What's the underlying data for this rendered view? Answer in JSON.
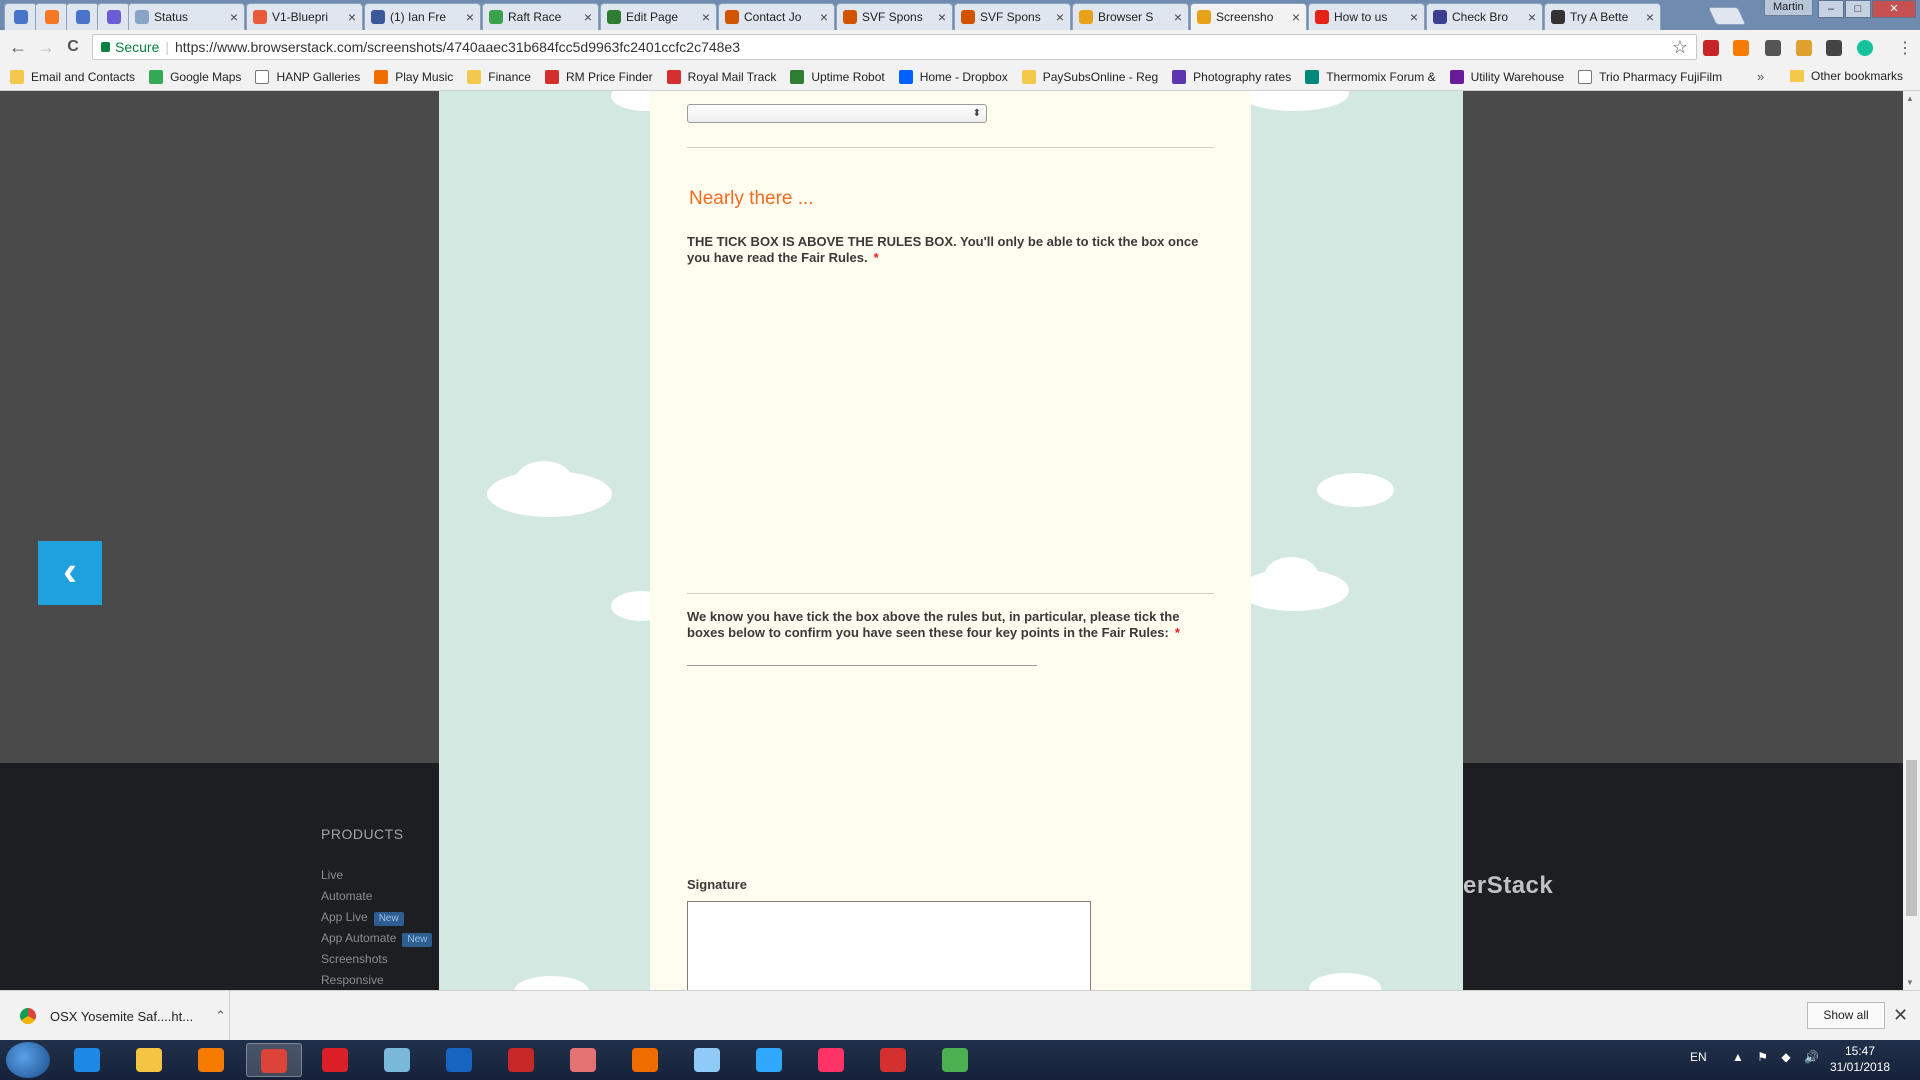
{
  "tabs": [
    {
      "title": "",
      "icon": "inbox-icon",
      "color": "#4a74c9",
      "pinned": true
    },
    {
      "title": "",
      "icon": "hubspot-icon",
      "color": "#f57722",
      "pinned": true
    },
    {
      "title": "",
      "icon": "rocket-icon",
      "color": "#4a74c9",
      "pinned": true
    },
    {
      "title": "",
      "icon": "circle-icon",
      "color": "#6b5bd6",
      "pinned": true
    },
    {
      "title": "Status",
      "icon": "status-icon",
      "color": "#8aa4c8"
    },
    {
      "title": "V1-Bluepri",
      "icon": "blueprint-icon",
      "color": "#e85a3a"
    },
    {
      "title": "(1) Ian Fre",
      "icon": "facebook-icon",
      "color": "#3b5998"
    },
    {
      "title": "Raft Race",
      "icon": "raft-icon",
      "color": "#39a24a"
    },
    {
      "title": "Edit Page",
      "icon": "edit-page-icon",
      "color": "#2e7d32"
    },
    {
      "title": "Contact Jo",
      "icon": "page-icon",
      "color": "#d35400"
    },
    {
      "title": "SVF Spons",
      "icon": "page-icon",
      "color": "#d35400"
    },
    {
      "title": "SVF Spons",
      "icon": "page-icon",
      "color": "#d35400"
    },
    {
      "title": "Browser S",
      "icon": "browserstack-icon",
      "color": "#e8a21a"
    },
    {
      "title": "Screensho",
      "icon": "browserstack-icon",
      "color": "#e8a21a",
      "active": true
    },
    {
      "title": "How to us",
      "icon": "youtube-icon",
      "color": "#e62117"
    },
    {
      "title": "Check Bro",
      "icon": "shield-icon",
      "color": "#3b3f8f"
    },
    {
      "title": "Try A Bette",
      "icon": "github-icon",
      "color": "#333333"
    }
  ],
  "window": {
    "profile": "Martin",
    "min": "–",
    "max": "□",
    "close": "✕"
  },
  "toolbar": {
    "back": "←",
    "forward": "→",
    "reload": "C",
    "secure_label": "Secure",
    "url": "https://www.browserstack.com/screenshots/4740aaec31b684fcc5d9963fc2401ccfc2c748e3",
    "star": "☆",
    "menu": "⋮"
  },
  "bookmarks": [
    {
      "label": "Email and Contacts",
      "icon": "folder-icon",
      "color": "#f2c94c"
    },
    {
      "label": "Google Maps",
      "icon": "maps-icon",
      "color": "#34a853"
    },
    {
      "label": "HANP Galleries",
      "icon": "page-icon",
      "color": "#ffffff"
    },
    {
      "label": "Play Music",
      "icon": "play-music-icon",
      "color": "#ef6c00"
    },
    {
      "label": "Finance",
      "icon": "folder-icon",
      "color": "#f2c94c"
    },
    {
      "label": "RM Price Finder",
      "icon": "royal-mail-icon",
      "color": "#d32f2f"
    },
    {
      "label": "Royal Mail Track",
      "icon": "royal-mail-icon",
      "color": "#d32f2f"
    },
    {
      "label": "Uptime Robot",
      "icon": "uptime-icon",
      "color": "#2e7d32"
    },
    {
      "label": "Home - Dropbox",
      "icon": "dropbox-icon",
      "color": "#0061ff"
    },
    {
      "label": "PaySubsOnline - Reg",
      "icon": "folder-icon",
      "color": "#f2c94c"
    },
    {
      "label": "Photography rates",
      "icon": "photo-icon",
      "color": "#5e35b1"
    },
    {
      "label": "Thermomix Forum &",
      "icon": "forum-icon",
      "color": "#00897b"
    },
    {
      "label": "Utility Warehouse",
      "icon": "utility-icon",
      "color": "#6a1b9a"
    },
    {
      "label": "Trio Pharmacy FujiFilm",
      "icon": "page-icon",
      "color": "#ffffff"
    }
  ],
  "bookmarks_more": "»",
  "other_bookmarks": "Other bookmarks",
  "form": {
    "section_heading": "Nearly there ...",
    "tickbox_label": "THE TICK BOX IS ABOVE THE RULES BOX. You'll only be able to tick the box once you have read the Fair Rules.",
    "keypoints_label": "We know you have tick the box above the rules but, in particular, please tick the boxes below to confirm you have seen these four key points in the Fair Rules:",
    "required_mark": "*",
    "signature_label": "Signature"
  },
  "footer": {
    "products_heading": "PRODUCTS",
    "links": [
      {
        "label": "Live",
        "badge": ""
      },
      {
        "label": "Automate",
        "badge": ""
      },
      {
        "label": "App Live",
        "badge": "New"
      },
      {
        "label": "App Automate",
        "badge": "New"
      },
      {
        "label": "Screenshots",
        "badge": ""
      },
      {
        "label": "Responsive",
        "badge": ""
      }
    ],
    "brand_partial": "wserStack"
  },
  "back_button": "‹",
  "download": {
    "file": "OSX Yosemite Saf....ht...",
    "show_all": "Show all",
    "close": "✕"
  },
  "taskbar": {
    "apps": [
      {
        "icon": "ie-icon",
        "color": "#1e88e5"
      },
      {
        "icon": "file-explorer-icon",
        "color": "#f4c542"
      },
      {
        "icon": "media-player-icon",
        "color": "#f57c00"
      },
      {
        "icon": "chrome-icon",
        "color": "#db4437",
        "active": true
      },
      {
        "icon": "creative-cloud-icon",
        "color": "#da1f26"
      },
      {
        "icon": "notes-icon",
        "color": "#7ab8d9"
      },
      {
        "icon": "ldp-icon",
        "color": "#1565c0"
      },
      {
        "icon": "can-icon",
        "color": "#c62828"
      },
      {
        "icon": "snipping-icon",
        "color": "#e57373"
      },
      {
        "icon": "blender-icon",
        "color": "#ef6c00"
      },
      {
        "icon": "network-icon",
        "color": "#90caf9"
      },
      {
        "icon": "lightroom-icon",
        "color": "#31a8ff"
      },
      {
        "icon": "indesign-icon",
        "color": "#ff3366"
      },
      {
        "icon": "acrobat-icon",
        "color": "#d32f2f"
      },
      {
        "icon": "photo-viewer-icon",
        "color": "#4caf50"
      }
    ],
    "lang": "EN",
    "time": "15:47",
    "date": "31/01/2018"
  }
}
